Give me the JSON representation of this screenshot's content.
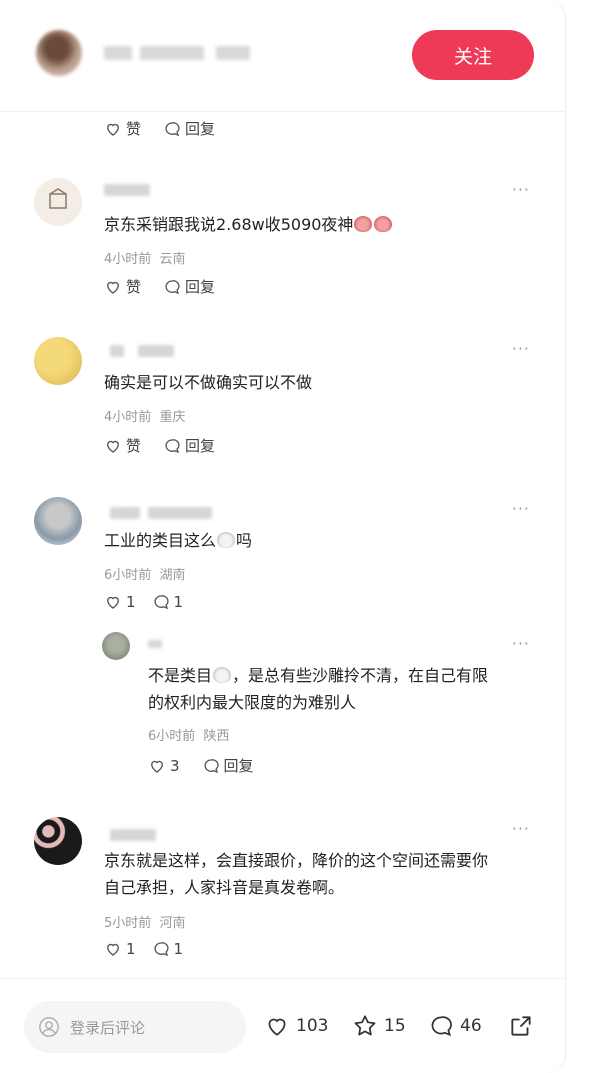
{
  "header": {
    "follow_label": "关注"
  },
  "top_actions": {
    "like": "赞",
    "reply": "回复"
  },
  "comments": [
    {
      "text_a": "京东采销跟我说2.68w收5090夜神",
      "time": "4小时前",
      "region": "云南",
      "like": "赞",
      "reply": "回复"
    },
    {
      "text": "确实是可以不做确实可以不做",
      "time": "4小时前",
      "region": "重庆",
      "like": "赞",
      "reply": "回复"
    },
    {
      "text_a": "工业的类目这么",
      "text_b": "吗",
      "time": "6小时前",
      "region": "湖南",
      "like": "1",
      "reply": "1"
    },
    {
      "text_a": "不是类目",
      "text_b": "，是总有些沙雕拎不清，在自己有限",
      "text_line2": "的权利内最大限度的为难别人",
      "time": "6小时前",
      "region": "陕西",
      "like": "3",
      "reply": "回复"
    },
    {
      "text_line1": "京东就是这样，会直接跟价，降价的这个空间还需要你",
      "text_line2": "自己承担，人家抖音是真发卷啊。",
      "time": "5小时前",
      "region": "河南",
      "like": "1",
      "reply": "1"
    }
  ],
  "more_label": "···",
  "bottom": {
    "placeholder": "登录后评论",
    "likes": "103",
    "stars": "15",
    "comments": "46"
  },
  "colors": {
    "accent": "#ee3a56"
  },
  "icons": [
    "heart-icon",
    "comment-bubble-icon",
    "star-icon",
    "share-icon",
    "user-icon"
  ]
}
